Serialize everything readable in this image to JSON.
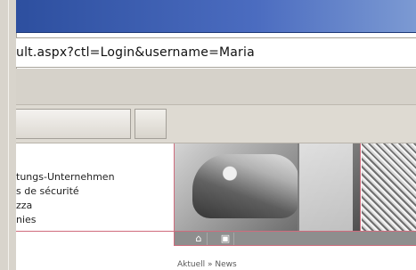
{
  "address_bar": {
    "url": "ult.aspx?ctl=Login&username=Maria"
  },
  "page": {
    "company_list": [
      "tungs-Unternehmen",
      "s de sécurité",
      "zza",
      "nies"
    ],
    "breadcrumb": "Aktuell » News"
  },
  "icons": {
    "home": "home-icon",
    "print": "print-icon"
  }
}
